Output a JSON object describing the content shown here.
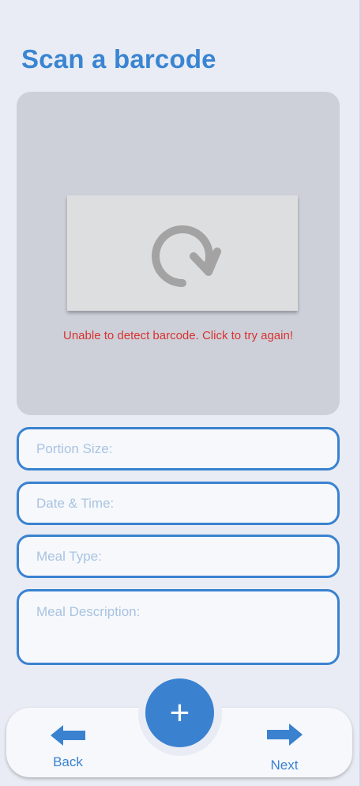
{
  "page": {
    "title": "Scan a barcode"
  },
  "scanner": {
    "retry_icon": "refresh-icon",
    "error_message": "Unable to detect barcode. Click to try again!"
  },
  "form": {
    "portion_size_placeholder": "Portion Size:",
    "datetime_placeholder": "Date & Time:",
    "meal_type_placeholder": "Meal Type:",
    "meal_description_placeholder": "Meal Description:"
  },
  "nav": {
    "back_label": "Back",
    "next_label": "Next",
    "add_symbol": "+"
  },
  "colors": {
    "accent": "#3a82d0",
    "title": "#3a85d2",
    "error": "#d83232",
    "background": "#e9ecf4"
  }
}
